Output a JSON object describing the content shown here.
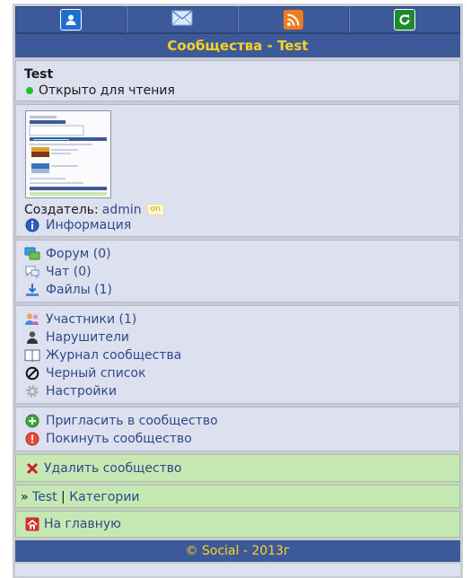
{
  "nav": {
    "items": [
      {
        "icon": "user-icon",
        "color": "#1f6fd0"
      },
      {
        "icon": "mail-icon",
        "color": "#2f7fe0"
      },
      {
        "icon": "rss-icon",
        "color": "#f07d1c"
      },
      {
        "icon": "refresh-icon",
        "color": "#1e8a2e"
      }
    ]
  },
  "title": "Сообщества - Test",
  "community": {
    "name": "Test",
    "status": "Открыто для чтения",
    "creator_label": "Создатель: ",
    "creator_name": "admin",
    "creator_badge": "on",
    "info_label": "Информация"
  },
  "sections": {
    "forum": "Форум (0)",
    "chat": "Чат (0)",
    "files": "Файлы (1)",
    "members": "Участники (1)",
    "violators": "Нарушители",
    "journal": "Журнал сообщества",
    "blacklist": "Черный список",
    "settings": "Настройки",
    "invite": "Пригласить в сообщество",
    "leave": "Покинуть сообщество",
    "delete": "Удалить сообщество"
  },
  "breadcrumb": {
    "prefix": "» ",
    "current": "Test",
    "separator": " | ",
    "categories": "Категории"
  },
  "home": "На главную",
  "footer": "© Social - 2013г",
  "colors": {
    "bar": "#3c5a9a",
    "accent": "#ffd21f",
    "block": "#dde0ef",
    "green": "#c6e9b4",
    "link": "#2f4a8a"
  }
}
